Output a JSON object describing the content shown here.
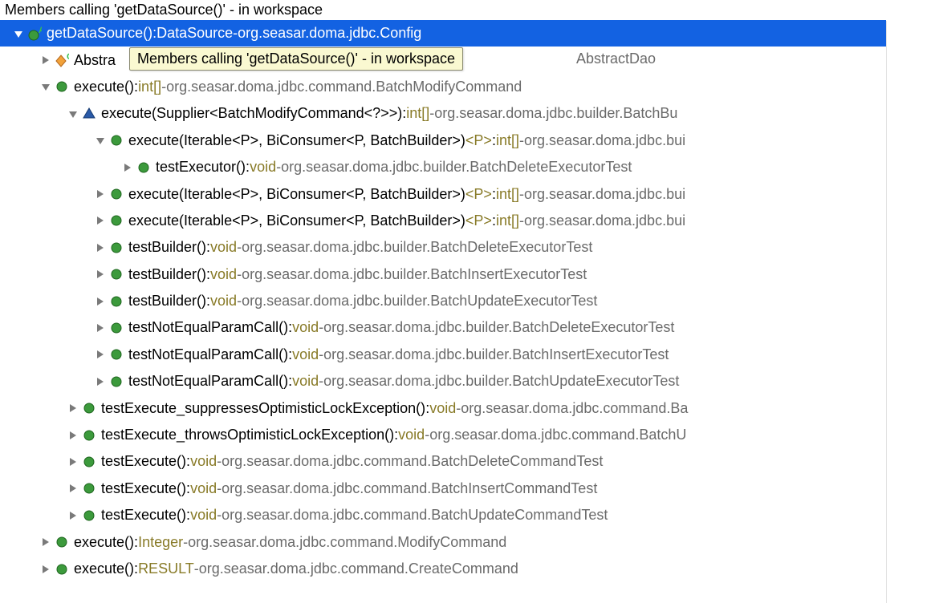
{
  "title": "Members calling 'getDataSource()' - in workspace",
  "tooltip": "Members calling 'getDataSource()' - in workspace",
  "visible_background_text": "AbstractDao",
  "visible_background_prefix": "Abstra",
  "colors": {
    "selection": "#1362e2",
    "returnType": "#887a27",
    "package": "#6a6a6a",
    "tooltipBg": "#faf9d1"
  },
  "nodes": [
    {
      "depth": 0,
      "expand": "open-white",
      "icon": "abstract-method",
      "name": "getDataSource()",
      "ret": "DataSource",
      "pkg": "org.seasar.doma.jdbc.Config",
      "selected": true
    },
    {
      "depth": 1,
      "expand": "closed",
      "icon": "class-cj",
      "name": "Abstra",
      "ret": "",
      "pkg": "",
      "selected": false,
      "truncated_name_only": true
    },
    {
      "depth": 1,
      "expand": "open",
      "icon": "public-method",
      "name": "execute()",
      "ret": "int[]",
      "pkg": "org.seasar.doma.jdbc.command.BatchModifyCommand",
      "selected": false
    },
    {
      "depth": 2,
      "expand": "open",
      "icon": "default-method",
      "name": "execute(Supplier<BatchModifyCommand<?>>)",
      "ret": "int[]",
      "pkg": "org.seasar.doma.jdbc.builder.BatchBu",
      "selected": false
    },
    {
      "depth": 3,
      "expand": "open",
      "icon": "public-method",
      "name": "execute(Iterable<P>, BiConsumer<P, BatchBuilder>)",
      "generic": "<P>",
      "ret": "int[]",
      "pkg": "org.seasar.doma.jdbc.bui",
      "selected": false
    },
    {
      "depth": 4,
      "expand": "closed",
      "icon": "public-method",
      "name": "testExecutor()",
      "ret": "void",
      "pkg": "org.seasar.doma.jdbc.builder.BatchDeleteExecutorTest",
      "selected": false
    },
    {
      "depth": 3,
      "expand": "closed",
      "icon": "public-method",
      "name": "execute(Iterable<P>, BiConsumer<P, BatchBuilder>)",
      "generic": "<P>",
      "ret": "int[]",
      "pkg": "org.seasar.doma.jdbc.bui",
      "selected": false
    },
    {
      "depth": 3,
      "expand": "closed",
      "icon": "public-method",
      "name": "execute(Iterable<P>, BiConsumer<P, BatchBuilder>)",
      "generic": "<P>",
      "ret": "int[]",
      "pkg": "org.seasar.doma.jdbc.bui",
      "selected": false
    },
    {
      "depth": 3,
      "expand": "closed",
      "icon": "public-method",
      "name": "testBuilder()",
      "ret": "void",
      "pkg": "org.seasar.doma.jdbc.builder.BatchDeleteExecutorTest",
      "selected": false
    },
    {
      "depth": 3,
      "expand": "closed",
      "icon": "public-method",
      "name": "testBuilder()",
      "ret": "void",
      "pkg": "org.seasar.doma.jdbc.builder.BatchInsertExecutorTest",
      "selected": false
    },
    {
      "depth": 3,
      "expand": "closed",
      "icon": "public-method",
      "name": "testBuilder()",
      "ret": "void",
      "pkg": "org.seasar.doma.jdbc.builder.BatchUpdateExecutorTest",
      "selected": false
    },
    {
      "depth": 3,
      "expand": "closed",
      "icon": "public-method",
      "name": "testNotEqualParamCall()",
      "ret": "void",
      "pkg": "org.seasar.doma.jdbc.builder.BatchDeleteExecutorTest",
      "selected": false
    },
    {
      "depth": 3,
      "expand": "closed",
      "icon": "public-method",
      "name": "testNotEqualParamCall()",
      "ret": "void",
      "pkg": "org.seasar.doma.jdbc.builder.BatchInsertExecutorTest",
      "selected": false
    },
    {
      "depth": 3,
      "expand": "closed",
      "icon": "public-method",
      "name": "testNotEqualParamCall()",
      "ret": "void",
      "pkg": "org.seasar.doma.jdbc.builder.BatchUpdateExecutorTest",
      "selected": false
    },
    {
      "depth": 2,
      "expand": "closed",
      "icon": "public-method",
      "name": "testExecute_suppressesOptimisticLockException()",
      "ret": "void",
      "pkg": "org.seasar.doma.jdbc.command.Ba",
      "selected": false
    },
    {
      "depth": 2,
      "expand": "closed",
      "icon": "public-method",
      "name": "testExecute_throwsOptimisticLockException()",
      "ret": "void",
      "pkg": "org.seasar.doma.jdbc.command.BatchU",
      "selected": false
    },
    {
      "depth": 2,
      "expand": "closed",
      "icon": "public-method",
      "name": "testExecute()",
      "ret": "void",
      "pkg": "org.seasar.doma.jdbc.command.BatchDeleteCommandTest",
      "selected": false
    },
    {
      "depth": 2,
      "expand": "closed",
      "icon": "public-method",
      "name": "testExecute()",
      "ret": "void",
      "pkg": "org.seasar.doma.jdbc.command.BatchInsertCommandTest",
      "selected": false
    },
    {
      "depth": 2,
      "expand": "closed",
      "icon": "public-method",
      "name": "testExecute()",
      "ret": "void",
      "pkg": "org.seasar.doma.jdbc.command.BatchUpdateCommandTest",
      "selected": false
    },
    {
      "depth": 1,
      "expand": "closed",
      "icon": "public-method",
      "name": "execute()",
      "ret": "Integer",
      "pkg": "org.seasar.doma.jdbc.command.ModifyCommand",
      "selected": false
    },
    {
      "depth": 1,
      "expand": "closed",
      "icon": "public-method",
      "name": "execute()",
      "ret": "RESULT",
      "pkg": "org.seasar.doma.jdbc.command.CreateCommand",
      "selected": false
    }
  ]
}
